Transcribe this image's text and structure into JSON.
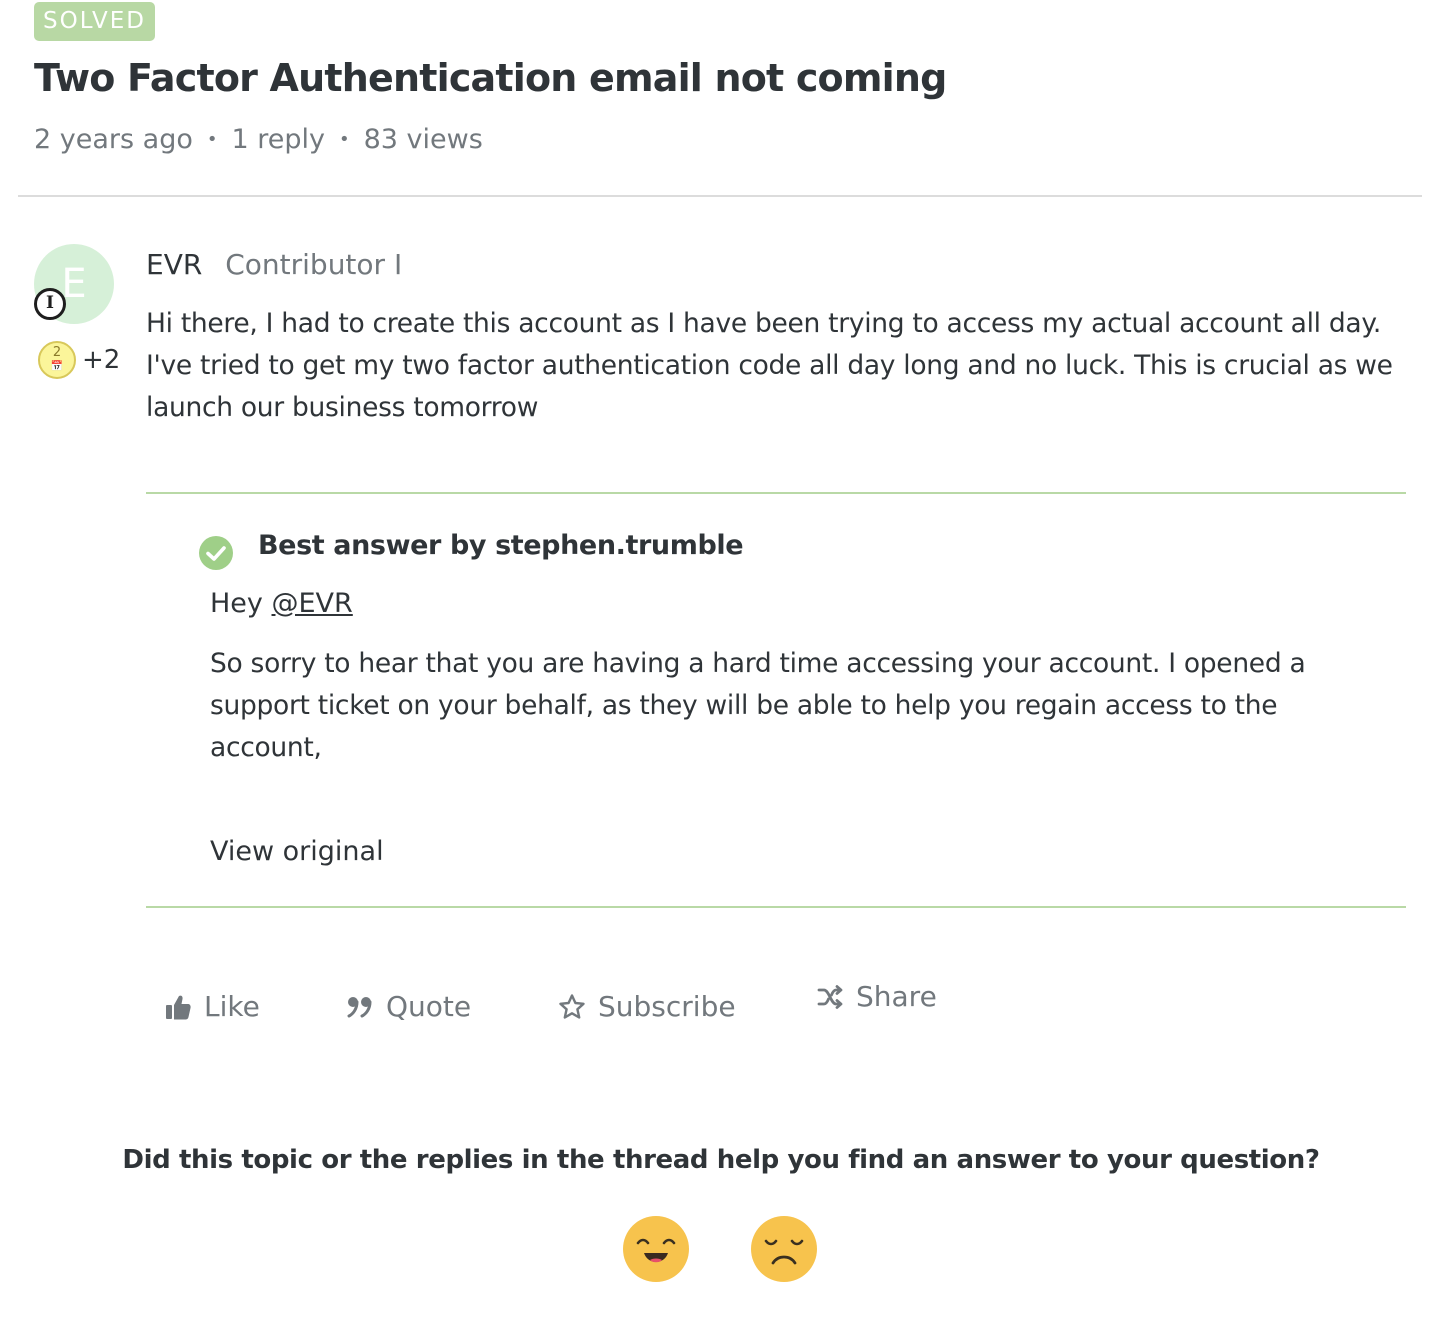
{
  "topic": {
    "status_badge": "SOLVED",
    "title": "Two Factor Authentication email not coming",
    "meta": {
      "age": "2 years ago",
      "replies": "1 reply",
      "views": "83 views",
      "separator": "•"
    }
  },
  "post": {
    "avatar_initial": "E",
    "rank_symbol": "I",
    "badge_number": "2",
    "badge_extra": "+2",
    "author_name": "EVR",
    "author_role": "Contributor I",
    "body": "Hi there, I had to create this account as I have been trying to access my actual account all day. I've tried to get my two factor authentication code all day long and no luck. This is crucial as we launch our business tomorrow"
  },
  "best_answer": {
    "heading": "Best answer by stephen.trumble",
    "greeting": "Hey",
    "mention": "@EVR",
    "body": "So sorry to hear that you are having a hard time accessing your account.  I opened a support ticket on your behalf, as they will be able to help you regain access to the account,",
    "view_original": "View original",
    "accent_color": "#9fcf88"
  },
  "actions": {
    "like": "Like",
    "quote": "Quote",
    "subscribe": "Subscribe",
    "share": "Share",
    "icons": [
      "thumbs-up-icon",
      "quote-icon",
      "star-icon",
      "shuffle-icon"
    ]
  },
  "feedback": {
    "question": "Did this topic or the replies in the thread help you find an answer to your question?",
    "emoji_color": "#f7c34d"
  }
}
